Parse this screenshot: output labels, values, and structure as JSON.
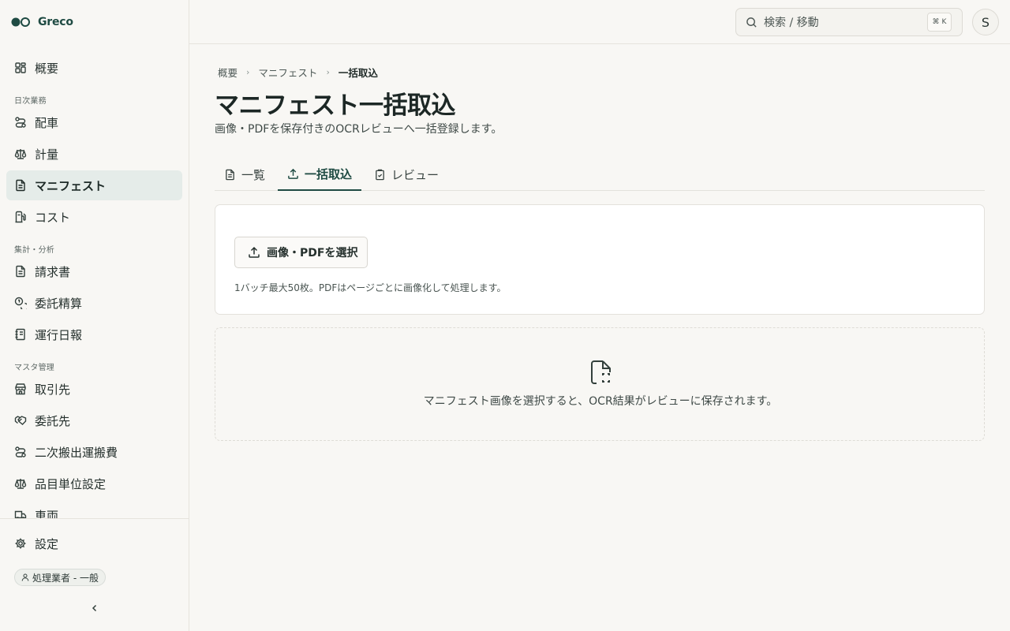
{
  "brand": {
    "name": "Greco",
    "logo_icon": "greco-logo-icon"
  },
  "sidebar": {
    "overview": {
      "label": "概要",
      "icon": "grid-icon"
    },
    "sections": [
      {
        "label": "日次業務",
        "items": [
          {
            "label": "配車",
            "icon": "route-icon"
          },
          {
            "label": "計量",
            "icon": "scale-icon"
          },
          {
            "label": "マニフェスト",
            "icon": "document-icon",
            "active": true
          },
          {
            "label": "コスト",
            "icon": "fuel-icon"
          }
        ]
      },
      {
        "label": "集計・分析",
        "items": [
          {
            "label": "請求書",
            "icon": "invoice-icon"
          },
          {
            "label": "委託精算",
            "icon": "coins-icon"
          },
          {
            "label": "運行日報",
            "icon": "notebook-icon"
          }
        ]
      },
      {
        "label": "マスタ管理",
        "items": [
          {
            "label": "取引先",
            "icon": "store-icon"
          },
          {
            "label": "委託先",
            "icon": "handshake-icon"
          },
          {
            "label": "二次搬出運搬費",
            "icon": "route-icon"
          },
          {
            "label": "品目単位設定",
            "icon": "scale-icon"
          },
          {
            "label": "車両",
            "icon": "truck-icon"
          }
        ]
      }
    ],
    "settings": {
      "label": "設定",
      "icon": "gear-icon"
    },
    "role_badge": "処理業者 - 一般",
    "collapse_icon": "chevron-left-icon"
  },
  "header": {
    "search_placeholder": "検索 / 移動",
    "shortcut_symbol": "⌘",
    "shortcut_key": "K",
    "avatar_initial": "S"
  },
  "breadcrumb": [
    "概要",
    "マニフェスト",
    "一括取込"
  ],
  "page": {
    "title": "マニフェスト一括取込",
    "subtitle": "画像・PDFを保存付きのOCRレビューへ一括登録します。"
  },
  "tabs": [
    {
      "label": "一覧",
      "icon": "file-icon",
      "active": false
    },
    {
      "label": "一括取込",
      "icon": "upload-icon",
      "active": true
    },
    {
      "label": "レビュー",
      "icon": "clipboard-check-icon",
      "active": false
    }
  ],
  "upload_card": {
    "button_label": "画像・PDFを選択",
    "button_icon": "upload-icon",
    "hint": "1バッチ最大50枚。PDFはページごとに画像化して処理します。"
  },
  "dropzone": {
    "icon": "file-scan-icon",
    "message": "マニフェスト画像を選択すると、OCR結果がレビューに保存されます。"
  },
  "colors": {
    "accent": "#1f4b43",
    "active_nav_bg": "#e5ece9",
    "background": "#f8f7f4"
  }
}
